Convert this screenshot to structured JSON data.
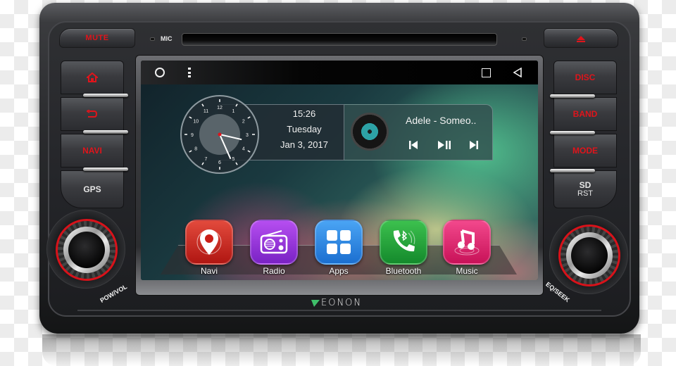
{
  "device": {
    "brand": "Eonon",
    "mic_label": "MIC",
    "accent_red": "#e0141b"
  },
  "top_buttons": {
    "mute_label": "MUTE",
    "eject_icon": "eject-icon"
  },
  "left_buttons": [
    {
      "label": "",
      "icon": "home-icon"
    },
    {
      "label": "",
      "icon": "back-arrow-icon"
    },
    {
      "label": "NAVI"
    },
    {
      "label": "GPS"
    }
  ],
  "right_buttons": [
    {
      "label": "DISC"
    },
    {
      "label": "BAND"
    },
    {
      "label": "MODE"
    },
    {
      "label": "SD",
      "sublabel": "RST"
    }
  ],
  "knobs": {
    "left_label": "POW/VOL",
    "right_label": "EQ/SEEK"
  },
  "screen": {
    "status_bar": {
      "left_icons": [
        "home-circle-icon",
        "overflow-menu-icon"
      ],
      "right_icons": [
        "recents-square-icon",
        "back-triangle-icon"
      ]
    },
    "clock": {
      "numerals": [
        "12",
        "1",
        "2",
        "3",
        "4",
        "5",
        "6",
        "7",
        "8",
        "9",
        "10",
        "11"
      ],
      "hour": 15,
      "minute": 26
    },
    "datetime": {
      "time": "15:26",
      "day": "Tuesday",
      "date": "Jan 3, 2017"
    },
    "music": {
      "title": "Adele - Someo..",
      "controls": [
        "previous-icon",
        "play-pause-icon",
        "next-icon"
      ]
    },
    "apps": [
      {
        "label": "Navi",
        "color": "#d42420",
        "icon": "map-pin-icon"
      },
      {
        "label": "Radio",
        "color": "#9230d0",
        "icon": "radio-icon"
      },
      {
        "label": "Apps",
        "color": "#2f8ae6",
        "icon": "app-grid-icon"
      },
      {
        "label": "Bluetooth",
        "color": "#1ea23a",
        "icon": "bluetooth-phone-icon"
      },
      {
        "label": "Music",
        "color": "#e0246e",
        "icon": "music-note-icon"
      }
    ]
  },
  "logo_text": "EONON"
}
